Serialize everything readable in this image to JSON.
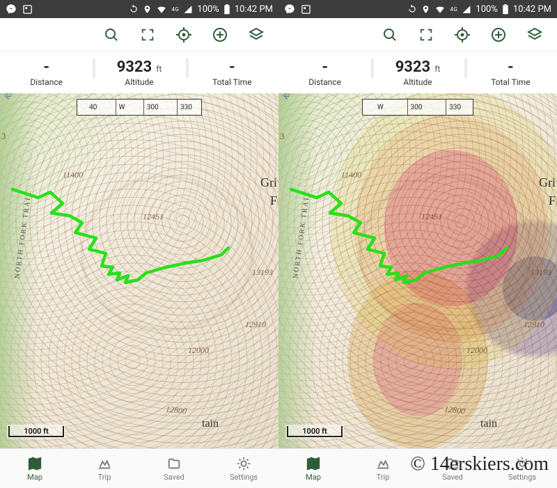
{
  "status": {
    "battery_pct": "100%",
    "time": "10:42 PM",
    "network_label": "4G"
  },
  "toolbar_icons": {
    "search": "search",
    "expand": "expand",
    "locate": "locate",
    "add": "add",
    "layers": "layers"
  },
  "stats": {
    "distance": {
      "value": "-",
      "label": "Distance"
    },
    "altitude": {
      "value": "9323",
      "unit": "ft",
      "label": "Altitude"
    },
    "totaltime": {
      "value": "-",
      "label": "Total Time"
    }
  },
  "compass": {
    "ticks_left": [
      "40",
      "W",
      "300",
      "330"
    ],
    "ticks_right": [
      "W",
      "300",
      "330"
    ]
  },
  "map": {
    "scale_label": "1000 ft",
    "elev_labels": {
      "a": "11400",
      "b": "12451",
      "c": "13193",
      "d": "12910",
      "e": "12000",
      "f": "12800"
    },
    "edge_label_right": "Gri",
    "edge_label_right_sub": "F",
    "edge_label_bottom": "tain",
    "left_label_a": "3",
    "vertical_trail_label": "NORTH    FORK    TRAIL",
    "river_label": "River"
  },
  "bottomnav": {
    "items": [
      {
        "key": "map",
        "label": "Map",
        "active": true
      },
      {
        "key": "trip",
        "label": "Trip",
        "active": false
      },
      {
        "key": "saved",
        "label": "Saved",
        "active": false
      },
      {
        "key": "settings",
        "label": "Settings",
        "active": false
      }
    ]
  },
  "watermark": "© 14erskiers.com"
}
